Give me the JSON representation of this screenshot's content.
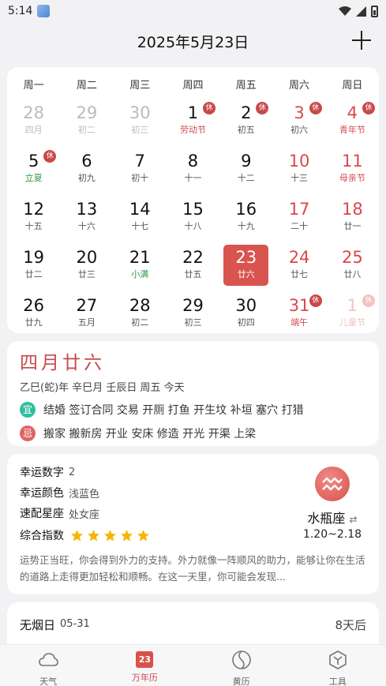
{
  "status": {
    "time": "5:14"
  },
  "header": {
    "title": "2025年5月23日"
  },
  "weekdays": [
    "周一",
    "周二",
    "周三",
    "周四",
    "周五",
    "周六",
    "周日"
  ],
  "days": [
    {
      "num": "28",
      "lunar": "四月",
      "cls": "other"
    },
    {
      "num": "29",
      "lunar": "初二",
      "cls": "other"
    },
    {
      "num": "30",
      "lunar": "初三",
      "cls": "other"
    },
    {
      "num": "1",
      "lunar": "劳动节",
      "cls": "festival",
      "badge": "休"
    },
    {
      "num": "2",
      "lunar": "初五",
      "cls": "",
      "badge": "休"
    },
    {
      "num": "3",
      "lunar": "初六",
      "cls": "weekend",
      "badge": "休"
    },
    {
      "num": "4",
      "lunar": "青年节",
      "cls": "red",
      "badge": "休"
    },
    {
      "num": "5",
      "lunar": "立夏",
      "cls": "term",
      "badge": "休"
    },
    {
      "num": "6",
      "lunar": "初九",
      "cls": ""
    },
    {
      "num": "7",
      "lunar": "初十",
      "cls": ""
    },
    {
      "num": "8",
      "lunar": "十一",
      "cls": ""
    },
    {
      "num": "9",
      "lunar": "十二",
      "cls": ""
    },
    {
      "num": "10",
      "lunar": "十三",
      "cls": "weekend"
    },
    {
      "num": "11",
      "lunar": "母亲节",
      "cls": "red"
    },
    {
      "num": "12",
      "lunar": "十五",
      "cls": ""
    },
    {
      "num": "13",
      "lunar": "十六",
      "cls": ""
    },
    {
      "num": "14",
      "lunar": "十七",
      "cls": ""
    },
    {
      "num": "15",
      "lunar": "十八",
      "cls": ""
    },
    {
      "num": "16",
      "lunar": "十九",
      "cls": ""
    },
    {
      "num": "17",
      "lunar": "二十",
      "cls": "weekend"
    },
    {
      "num": "18",
      "lunar": "廿一",
      "cls": "weekend"
    },
    {
      "num": "19",
      "lunar": "廿二",
      "cls": ""
    },
    {
      "num": "20",
      "lunar": "廿三",
      "cls": ""
    },
    {
      "num": "21",
      "lunar": "小满",
      "cls": "term"
    },
    {
      "num": "22",
      "lunar": "廿五",
      "cls": ""
    },
    {
      "num": "23",
      "lunar": "廿六",
      "cls": "selected"
    },
    {
      "num": "24",
      "lunar": "廿七",
      "cls": "weekend"
    },
    {
      "num": "25",
      "lunar": "廿八",
      "cls": "weekend"
    },
    {
      "num": "26",
      "lunar": "廿九",
      "cls": ""
    },
    {
      "num": "27",
      "lunar": "五月",
      "cls": ""
    },
    {
      "num": "28",
      "lunar": "初二",
      "cls": ""
    },
    {
      "num": "29",
      "lunar": "初三",
      "cls": ""
    },
    {
      "num": "30",
      "lunar": "初四",
      "cls": ""
    },
    {
      "num": "31",
      "lunar": "端午",
      "cls": "red",
      "badge": "休"
    },
    {
      "num": "1",
      "lunar": "儿童节",
      "cls": "fadered",
      "badge": "休"
    }
  ],
  "lunar_card": {
    "title": "四月廿六",
    "ganzhi": "乙巳(蛇)年 辛巳月 壬辰日 周五 今天",
    "yi_label": "宜",
    "yi_items": "结婚 签订合同 交易 开厕 打鱼 开生坟 补垣 塞穴 打猎",
    "ji_label": "忌",
    "ji_items": "搬家 搬新房 开业 安床 修造 开光 开渠 上梁"
  },
  "fortune": {
    "lucky_number_label": "幸运数字",
    "lucky_number": "2",
    "lucky_color_label": "幸运颜色",
    "lucky_color": "浅蓝色",
    "match_label": "速配星座",
    "match": "处女座",
    "index_label": "综合指数",
    "stars": 5,
    "zodiac_name": "水瓶座",
    "zodiac_swap": "⇄",
    "zodiac_range": "1.20~2.18",
    "desc": "运势正当旺，你会得到外力的支持。外力就像一阵顺风的助力，能够让你在生活的道路上走得更加轻松和顺畅。在这一天里，你可能会发现..."
  },
  "event": {
    "name": "无烟日",
    "date": "05-31",
    "days_left": "8天后"
  },
  "nav": [
    {
      "label": "天气",
      "icon": "cloud-icon"
    },
    {
      "label": "万年历",
      "icon": "calendar-icon",
      "active": true,
      "icon_text": "23"
    },
    {
      "label": "黄历",
      "icon": "yinyang-icon"
    },
    {
      "label": "工具",
      "icon": "toolbox-icon"
    }
  ],
  "colors": {
    "accent": "#d9534f",
    "term_green": "#2e9a45",
    "yi": "#31bfa0",
    "ji": "#e06565",
    "star": "#f7b500"
  }
}
